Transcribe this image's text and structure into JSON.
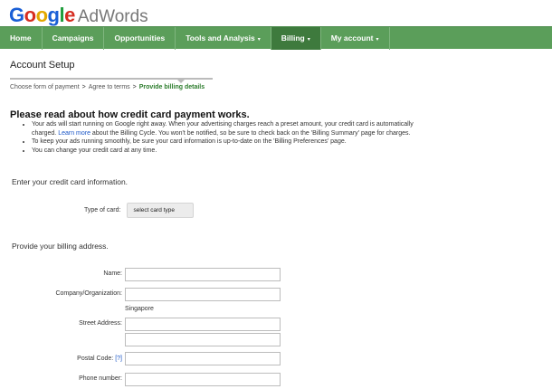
{
  "brand": {
    "logo_letters": [
      "G",
      "o",
      "o",
      "g",
      "l",
      "e"
    ],
    "product": "AdWords"
  },
  "nav": {
    "home": "Home",
    "campaigns": "Campaigns",
    "opportunities": "Opportunities",
    "tools": "Tools and Analysis",
    "billing": "Billing",
    "my_account": "My account",
    "caret": "▾"
  },
  "page": {
    "title": "Account Setup"
  },
  "steps": {
    "step1": "Choose form of payment",
    "step2": "Agree to terms",
    "step3": "Provide billing details",
    "separator": ">"
  },
  "notice": {
    "heading": "Please read about how credit card payment works.",
    "b1_pre": "Your ads will start running on Google right away. When your advertising charges reach a preset amount, your credit card is automatically charged. ",
    "b1_link": "Learn more",
    "b1_post": " about the Billing Cycle. You won't be notified, so be sure to check back on the 'Billing Summary' page for charges.",
    "b2": "To keep your ads running smoothly, be sure your card information is up-to-date on the 'Billing Preferences' page.",
    "b3": "You can change your credit card at any time."
  },
  "credit_card": {
    "heading": "Enter your credit card information.",
    "type_label": "Type of card:",
    "type_value": "select card type"
  },
  "billing_address": {
    "heading": "Provide your billing address.",
    "name_label": "Name:",
    "company_label": "Company/Organization:",
    "country_value": "Singapore",
    "street_label": "Street Address:",
    "postal_label": "Postal Code:",
    "postal_help": "[?]",
    "phone_label": "Phone number:"
  }
}
